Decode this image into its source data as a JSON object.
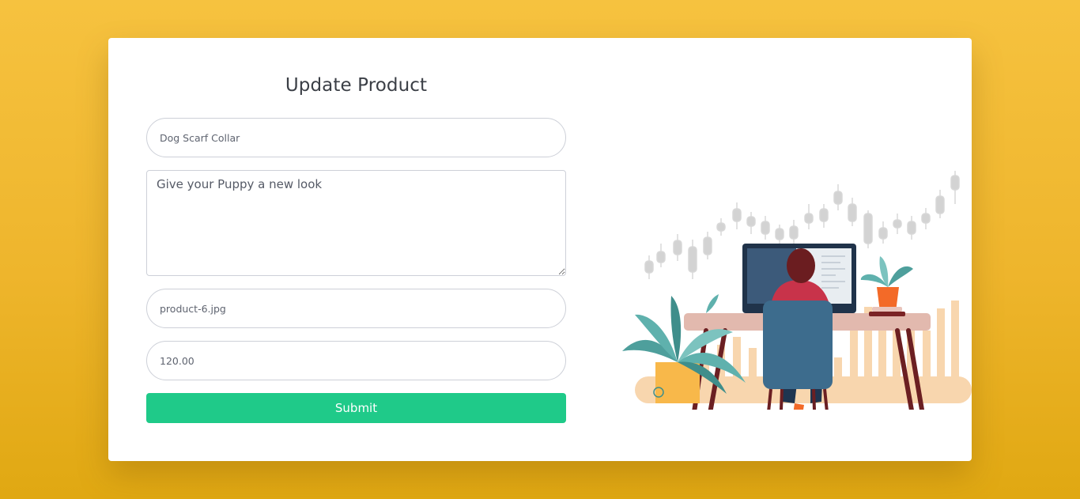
{
  "form": {
    "title": "Update Product",
    "name_value": "Dog Scarf Collar",
    "description_value": "Give your Puppy a new look",
    "image_value": "product-6.jpg",
    "price_value": "120.00",
    "submit_label": "Submit"
  },
  "colors": {
    "background": "#f0b92e",
    "card": "#ffffff",
    "submit": "#1fca89",
    "title_text": "#3b3f46"
  },
  "illustration": {
    "icon": "person-at-computer-desk-illustration"
  }
}
